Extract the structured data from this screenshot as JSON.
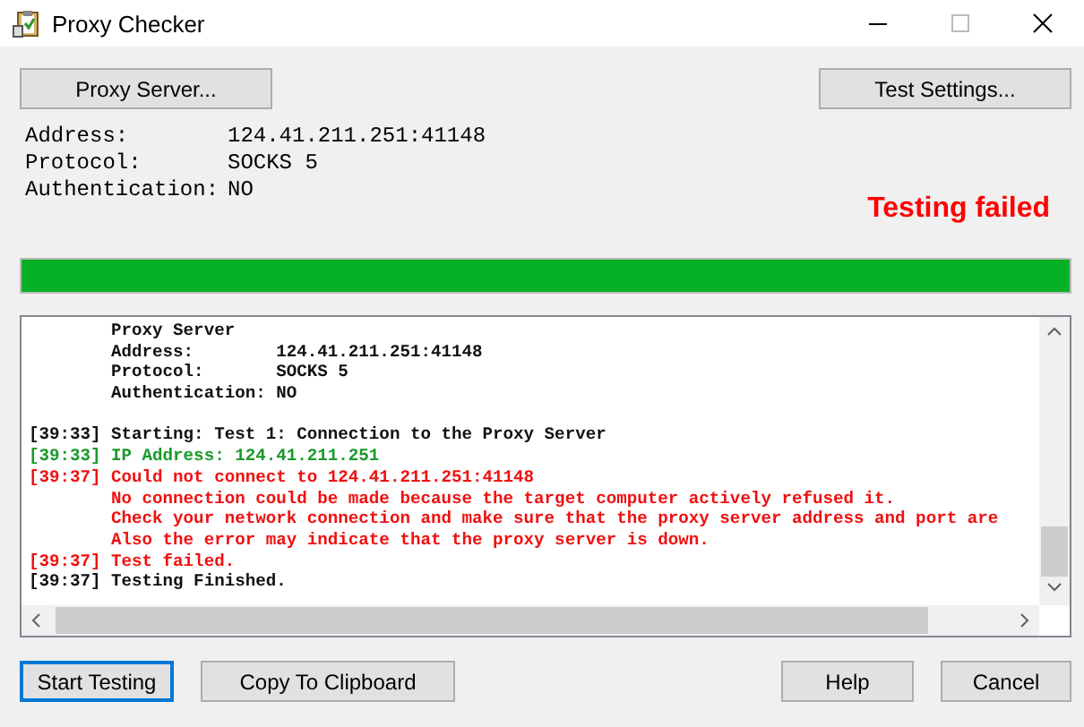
{
  "window": {
    "title": "Proxy Checker"
  },
  "top_buttons": [
    {
      "label": "Proxy Server..."
    },
    {
      "label": "Test Settings..."
    }
  ],
  "info": [
    {
      "label": "Address:",
      "value": "124.41.211.251:41148"
    },
    {
      "label": "Protocol:",
      "value": "SOCKS 5"
    },
    {
      "label": "Authentication:",
      "value": "NO"
    }
  ],
  "status": "Testing failed",
  "progress": {
    "level": 1
  },
  "log": [
    {
      "kind": "info",
      "text": "Proxy Server"
    },
    {
      "kind": "info",
      "text": "Address:        124.41.211.251:41148"
    },
    {
      "kind": "info",
      "text": "Protocol:       SOCKS 5"
    },
    {
      "kind": "info",
      "text": "Authentication: NO"
    },
    {
      "kind": "blank"
    },
    {
      "kind": "info",
      "time": "[39:33]",
      "text": "Starting: Test 1: Connection to the Proxy Server"
    },
    {
      "kind": "success",
      "time": "[39:33]",
      "text": "IP Address: 124.41.211.251"
    },
    {
      "kind": "error",
      "time": "[39:37]",
      "text": "Could not connect to 124.41.211.251:41148"
    },
    {
      "kind": "error",
      "text": "No connection could be made because the target computer actively refused it."
    },
    {
      "kind": "error",
      "text": "Check your network connection and make sure that the proxy server address and port are"
    },
    {
      "kind": "error",
      "text": "Also the error may indicate that the proxy server is down."
    },
    {
      "kind": "error",
      "time": "[39:37]",
      "text": "Test failed."
    },
    {
      "kind": "info",
      "time": "[39:37]",
      "text": "Testing Finished."
    }
  ],
  "bottom_buttons": [
    {
      "label": "Start Testing",
      "focused": true
    },
    {
      "label": "Copy To Clipboard",
      "focused": false
    },
    {
      "label": "Help",
      "focused": false
    },
    {
      "label": "Cancel",
      "focused": false
    }
  ]
}
